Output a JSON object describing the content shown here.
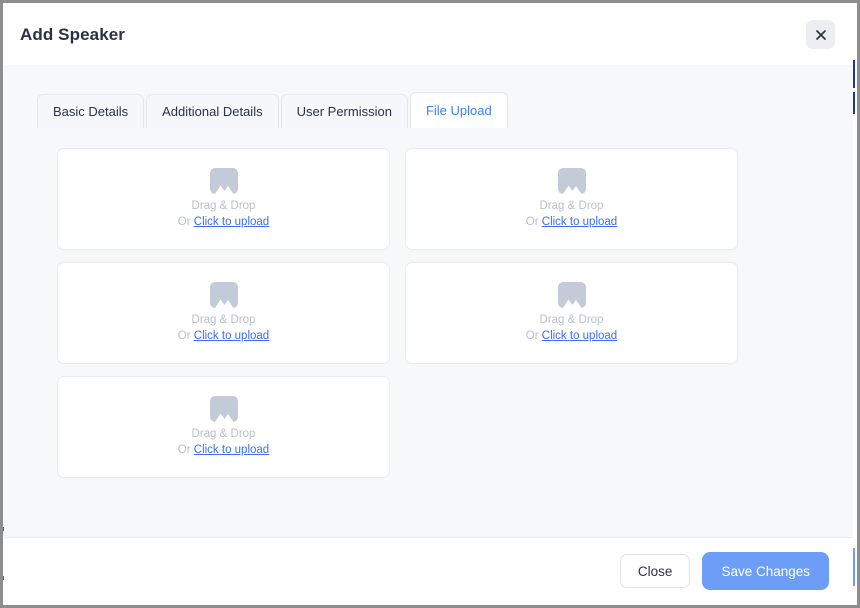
{
  "modal": {
    "title": "Add Speaker",
    "close_icon": "close-icon"
  },
  "tabs": [
    {
      "label": "Basic Details",
      "active": false
    },
    {
      "label": "Additional Details",
      "active": false
    },
    {
      "label": "User Permission",
      "active": false
    },
    {
      "label": "File Upload",
      "active": true
    }
  ],
  "upload": {
    "card_count": 5,
    "icon": "image-placeholder-icon",
    "drag_drop_label": "Drag & Drop",
    "or_label": "Or",
    "click_to_upload_label": "Click to upload"
  },
  "footer": {
    "close_label": "Close",
    "save_label": "Save Changes"
  },
  "colors": {
    "accent_blue": "#3b82f6",
    "link_blue": "#3b6ef5",
    "save_button": "#6c9ef7",
    "title_text": "#2b3148",
    "body_bg": "#f7f8fa",
    "placeholder_gray": "#c3cbd9",
    "muted_text": "#b8c0ce"
  }
}
